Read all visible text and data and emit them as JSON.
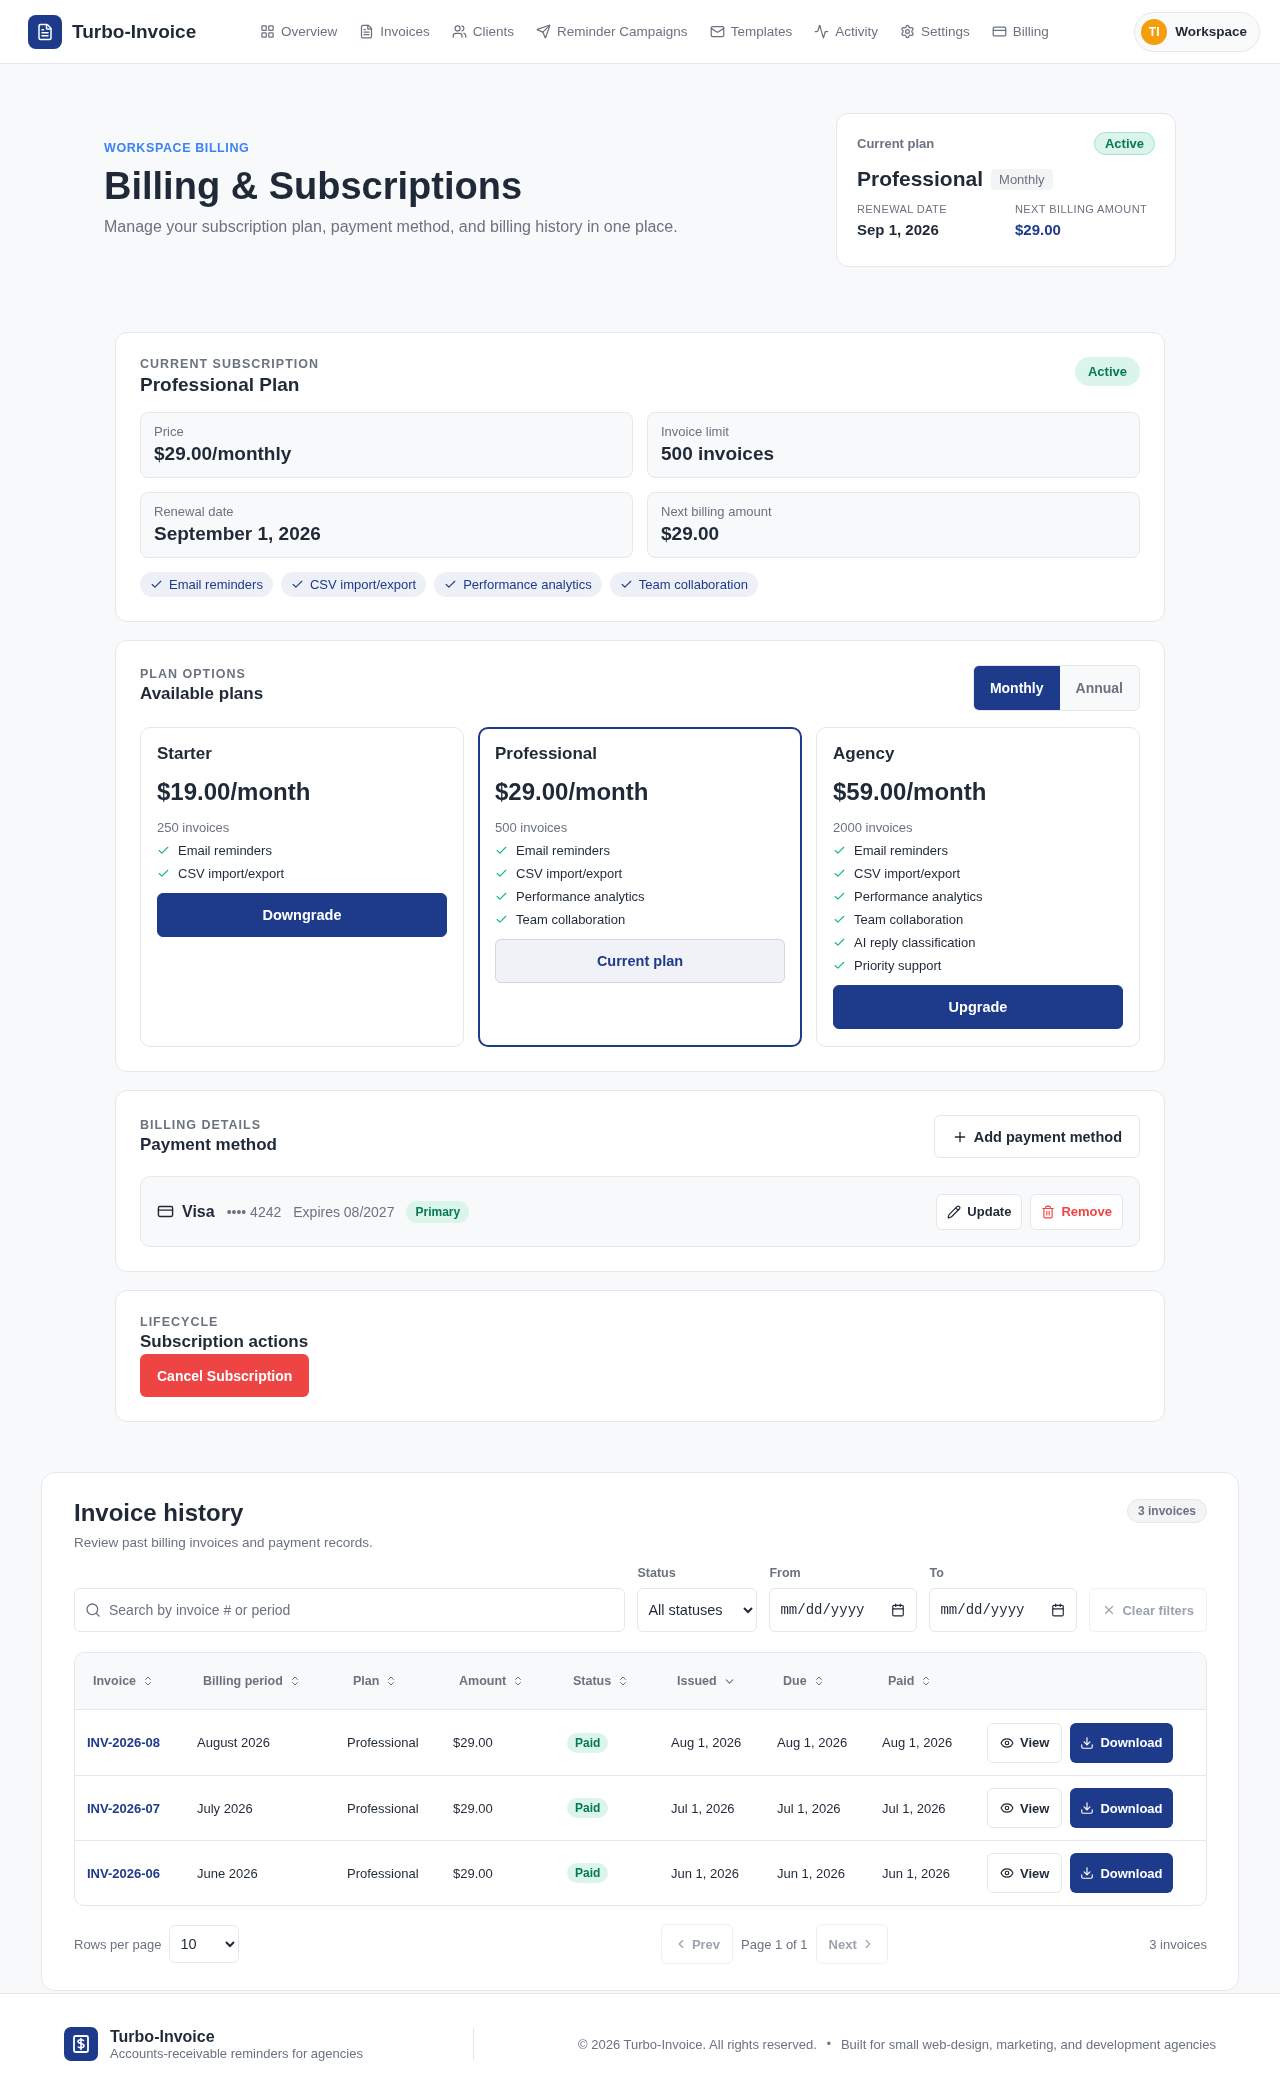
{
  "app": {
    "name": "Turbo-Invoice"
  },
  "nav": [
    {
      "label": "Overview"
    },
    {
      "label": "Invoices"
    },
    {
      "label": "Clients"
    },
    {
      "label": "Reminder Campaigns"
    },
    {
      "label": "Templates"
    },
    {
      "label": "Activity"
    },
    {
      "label": "Settings"
    },
    {
      "label": "Billing"
    }
  ],
  "workspace": {
    "initials": "TI",
    "label": "Workspace"
  },
  "hero": {
    "eyebrow": "WORKSPACE BILLING",
    "title": "Billing & Subscriptions",
    "subtitle": "Manage your subscription plan, payment method, and billing history in one place."
  },
  "plan_summary": {
    "label": "Current plan",
    "status": "Active",
    "plan": "Professional",
    "cycle": "Monthly",
    "renewal_label": "RENEWAL DATE",
    "renewal": "Sep 1, 2026",
    "amount_label": "NEXT BILLING AMOUNT",
    "amount": "$29.00"
  },
  "subscription": {
    "eyebrow": "CURRENT SUBSCRIPTION",
    "title": "Professional Plan",
    "status": "Active",
    "stats": [
      {
        "label": "Price",
        "value": "$29.00/monthly"
      },
      {
        "label": "Invoice limit",
        "value": "500 invoices"
      },
      {
        "label": "Renewal date",
        "value": "September 1, 2026"
      },
      {
        "label": "Next billing amount",
        "value": "$29.00"
      }
    ],
    "features": [
      "Email reminders",
      "CSV import/export",
      "Performance analytics",
      "Team collaboration"
    ]
  },
  "plans": {
    "eyebrow": "PLAN OPTIONS",
    "title": "Available plans",
    "cycles": [
      {
        "label": "Monthly",
        "selected": true
      },
      {
        "label": "Annual",
        "selected": false
      }
    ],
    "items": [
      {
        "name": "Starter",
        "price": "$19.00/month",
        "limit": "250 invoices",
        "selected": false,
        "features": [
          "Email reminders",
          "CSV import/export"
        ],
        "action": {
          "label": "Downgrade",
          "kind": "primary"
        }
      },
      {
        "name": "Professional",
        "price": "$29.00/month",
        "limit": "500 invoices",
        "selected": true,
        "features": [
          "Email reminders",
          "CSV import/export",
          "Performance analytics",
          "Team collaboration"
        ],
        "action": {
          "label": "Current plan",
          "kind": "current"
        }
      },
      {
        "name": "Agency",
        "price": "$59.00/month",
        "limit": "2000 invoices",
        "selected": false,
        "features": [
          "Email reminders",
          "CSV import/export",
          "Performance analytics",
          "Team collaboration",
          "AI reply classification",
          "Priority support"
        ],
        "action": {
          "label": "Upgrade",
          "kind": "primary"
        }
      }
    ]
  },
  "payment": {
    "eyebrow": "BILLING DETAILS",
    "title": "Payment method",
    "add_label": "Add payment method",
    "card": {
      "brand": "Visa",
      "number": "•••• 4242",
      "expires": "Expires 08/2027",
      "badge": "Primary",
      "update": "Update",
      "remove": "Remove"
    }
  },
  "lifecycle": {
    "eyebrow": "LIFECYCLE",
    "title": "Subscription actions",
    "cancel": "Cancel Subscription"
  },
  "history": {
    "title": "Invoice history",
    "subtitle": "Review past billing invoices and payment records.",
    "count": "3 invoices",
    "search": {
      "placeholder": "Search by invoice # or period"
    },
    "status_filter": {
      "label": "Status",
      "value": "All statuses"
    },
    "from": {
      "label": "From",
      "placeholder": "mm/dd/yyyy"
    },
    "to": {
      "label": "To",
      "placeholder": "mm/dd/yyyy"
    },
    "clear": "Clear filters",
    "columns": [
      {
        "label": "Invoice",
        "sorted": false
      },
      {
        "label": "Billing period",
        "sorted": false
      },
      {
        "label": "Plan",
        "sorted": false
      },
      {
        "label": "Amount",
        "sorted": false
      },
      {
        "label": "Status",
        "sorted": false
      },
      {
        "label": "Issued",
        "sorted": true
      },
      {
        "label": "Due",
        "sorted": false
      },
      {
        "label": "Paid",
        "sorted": false
      }
    ],
    "rows": [
      {
        "invoice": "INV-2026-08",
        "period": "August 2026",
        "plan": "Professional",
        "amount": "$29.00",
        "status": "Paid",
        "issued": "Aug 1, 2026",
        "due": "Aug 1, 2026",
        "paid": "Aug 1, 2026",
        "view": "View",
        "download": "Download"
      },
      {
        "invoice": "INV-2026-07",
        "period": "July 2026",
        "plan": "Professional",
        "amount": "$29.00",
        "status": "Paid",
        "issued": "Jul 1, 2026",
        "due": "Jul 1, 2026",
        "paid": "Jul 1, 2026",
        "view": "View",
        "download": "Download"
      },
      {
        "invoice": "INV-2026-06",
        "period": "June 2026",
        "plan": "Professional",
        "amount": "$29.00",
        "status": "Paid",
        "issued": "Jun 1, 2026",
        "due": "Jun 1, 2026",
        "paid": "Jun 1, 2026",
        "view": "View",
        "download": "Download"
      }
    ],
    "pagination": {
      "rows_label": "Rows per page",
      "rows_value": "10",
      "prev": "Prev",
      "page": "Page 1 of 1",
      "next": "Next",
      "total": "3 invoices"
    }
  },
  "footer": {
    "name": "Turbo-Invoice",
    "tagline": "Accounts-receivable reminders for agencies",
    "copyright": "© 2026 Turbo-Invoice. All rights reserved.",
    "separator": "•",
    "note": "Built for small web-design, marketing, and development agencies"
  }
}
